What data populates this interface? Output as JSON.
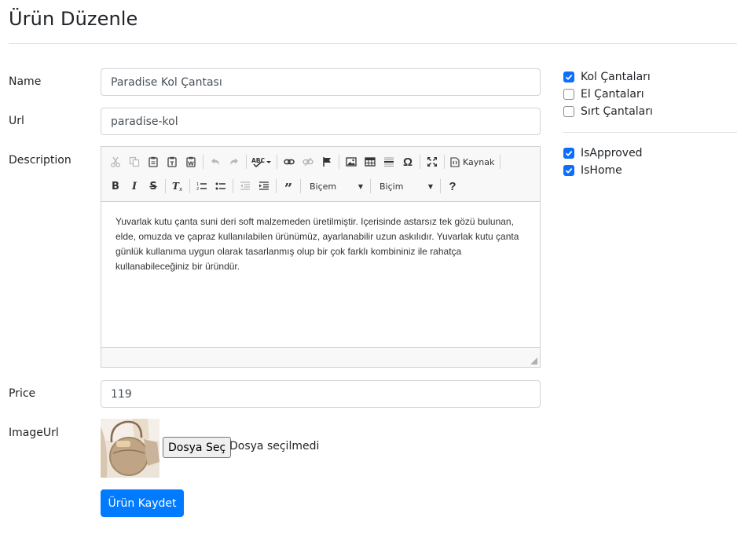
{
  "page": {
    "title": "Ürün Düzenle"
  },
  "form": {
    "name_label": "Name",
    "name_value": "Paradise Kol Çantası",
    "url_label": "Url",
    "url_value": "paradise-kol",
    "description_label": "Description",
    "description_text": "Yuvarlak kutu çanta suni deri soft malzemeden üretilmiştir. Içerisinde astarsız tek gözü bulunan, elde, omuzda ve çapraz kullanılabilen ürünümüz, ayarlanabilir uzun askılıdır. Yuvarlak kutu çanta günlük kullanıma uygun olarak tasarlanmış olup bir çok farklı kombininiz ile rahatça kullanabileceğiniz bir üründür.",
    "price_label": "Price",
    "price_value": "119",
    "image_label": "ImageUrl",
    "file_button_label": "Dosya Seç",
    "file_status": "Dosya seçilmedi",
    "save_label": "Ürün Kaydet"
  },
  "editor": {
    "source_label": "Kaynak",
    "styles_label": "Biçem",
    "format_label": "Biçim"
  },
  "categories": [
    {
      "label": "Kol Çantaları",
      "checked": true
    },
    {
      "label": "El Çantaları",
      "checked": false
    },
    {
      "label": "Sırt Çantaları",
      "checked": false
    }
  ],
  "flags": [
    {
      "label": "IsApproved",
      "checked": true
    },
    {
      "label": "IsHome",
      "checked": true
    }
  ],
  "colors": {
    "primary": "#007bff",
    "checkbox": "#0d6efd"
  }
}
